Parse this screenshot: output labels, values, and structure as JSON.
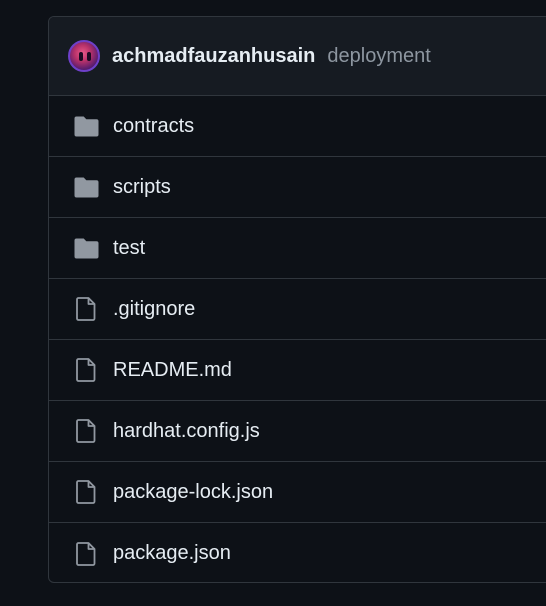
{
  "commit": {
    "author": "achmadfauzanhusain",
    "message": "deployment",
    "avatar_icon": "user-avatar"
  },
  "entries": [
    {
      "name": "contracts",
      "type": "directory",
      "icon": "folder-icon"
    },
    {
      "name": "scripts",
      "type": "directory",
      "icon": "folder-icon"
    },
    {
      "name": "test",
      "type": "directory",
      "icon": "folder-icon"
    },
    {
      "name": ".gitignore",
      "type": "file",
      "icon": "file-icon"
    },
    {
      "name": "README.md",
      "type": "file",
      "icon": "file-icon"
    },
    {
      "name": "hardhat.config.js",
      "type": "file",
      "icon": "file-icon"
    },
    {
      "name": "package-lock.json",
      "type": "file",
      "icon": "file-icon"
    },
    {
      "name": "package.json",
      "type": "file",
      "icon": "file-icon"
    }
  ],
  "colors": {
    "background": "#0d1117",
    "header_background": "#161b22",
    "border": "#30363d",
    "text": "#e6edf3",
    "muted_text": "#8d96a0",
    "icon": "#9198a1"
  }
}
